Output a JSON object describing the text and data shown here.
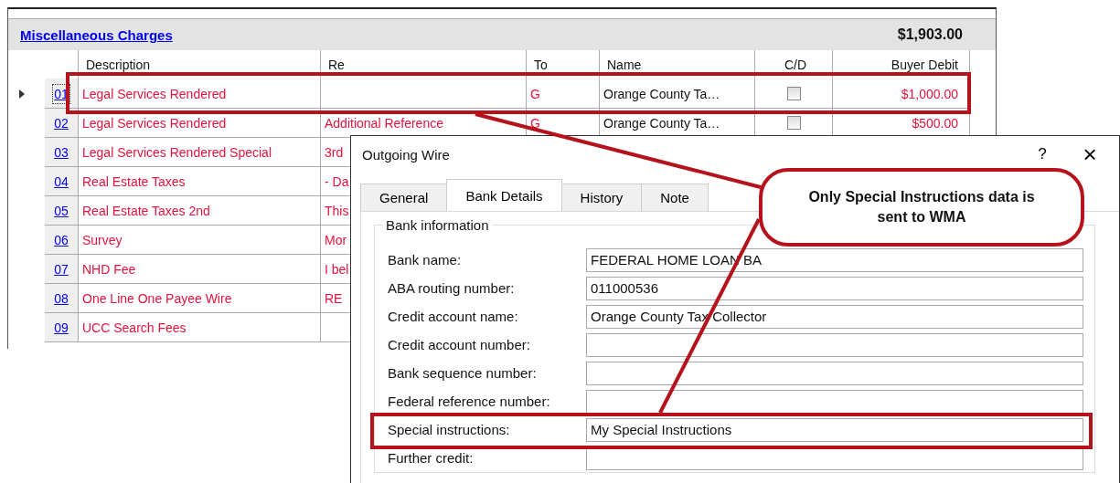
{
  "charges_window": {
    "title": "Miscellaneous Charges",
    "total": "$1,903.00",
    "columns": [
      "Description",
      "Re",
      "To",
      "Name",
      "C/D",
      "Buyer Debit"
    ],
    "rows": [
      {
        "number": "01",
        "description": "Legal Services Rendered",
        "re": "",
        "to": "G",
        "name": "Orange County Ta…",
        "cd_checked": false,
        "buyer_debit": "$1,000.00",
        "selected": true
      },
      {
        "number": "02",
        "description": "Legal Services Rendered",
        "re": "Additional Reference",
        "to": "G",
        "name": "Orange County Ta…",
        "cd_checked": false,
        "buyer_debit": "$500.00",
        "selected": false
      },
      {
        "number": "03",
        "description": "Legal Services Rendered Special",
        "re": "3rd",
        "selected": false
      },
      {
        "number": "04",
        "description": "Real Estate Taxes",
        "re": "- Da",
        "selected": false
      },
      {
        "number": "05",
        "description": "Real Estate Taxes 2nd",
        "re": "This",
        "selected": false
      },
      {
        "number": "06",
        "description": "Survey",
        "re": "Mor",
        "selected": false
      },
      {
        "number": "07",
        "description": "NHD Fee",
        "re": "I bel",
        "selected": false
      },
      {
        "number": "08",
        "description": "One Line One Payee Wire",
        "re": "RE",
        "selected": false
      },
      {
        "number": "09",
        "description": "UCC Search Fees",
        "re": "",
        "selected": false
      }
    ]
  },
  "dialog": {
    "title": "Outgoing Wire",
    "help": "?",
    "close": "×",
    "tabs": [
      {
        "label": "General",
        "selected": false
      },
      {
        "label": "Bank Details",
        "selected": true
      },
      {
        "label": "History",
        "selected": false
      },
      {
        "label": "Note",
        "selected": false
      }
    ],
    "group_title": "Bank information",
    "fields": [
      {
        "label": "Bank name:",
        "value": "FEDERAL HOME LOAN BA"
      },
      {
        "label": "ABA routing number:",
        "value": "011000536"
      },
      {
        "label": "Credit account name:",
        "value": "Orange County Tax Collector"
      },
      {
        "label": "Credit account number:"
      },
      {
        "label": "Bank sequence number:"
      },
      {
        "label": "Federal reference number:"
      },
      {
        "label": "Special instructions:",
        "value": "My Special Instructions"
      },
      {
        "label": "Further credit:"
      }
    ]
  },
  "callout": {
    "text": "Only Special Instructions data is sent to WMA"
  }
}
